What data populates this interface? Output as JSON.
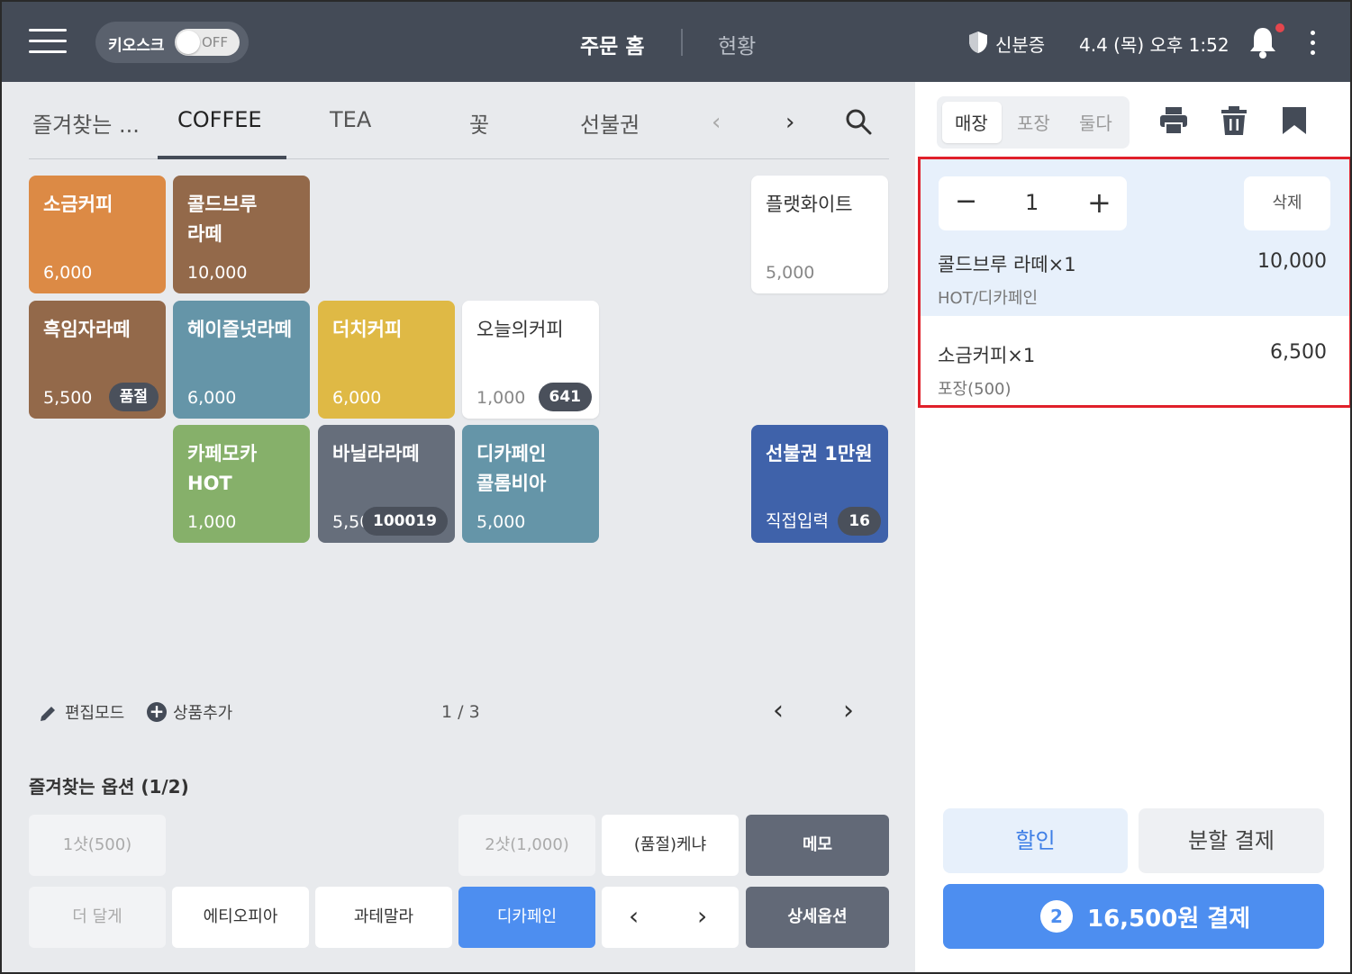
{
  "topbar": {
    "kiosk_label": "키오스크",
    "kiosk_toggle": "OFF",
    "nav_home": "주문 홈",
    "nav_status": "현황",
    "id_label": "신분증",
    "datetime": "4.4 (목) 오후 1:52"
  },
  "tabs": [
    "즐겨찾는 ...",
    "COFFEE",
    "TEA",
    "꽃",
    "선불권"
  ],
  "tiles": [
    {
      "name": "소금커피",
      "price": "6,000",
      "color": "#dc8a45"
    },
    {
      "name": "콜드브루\n라떼",
      "price": "10,000",
      "color": "#93694a"
    },
    {
      "name": "플랫화이트",
      "price": "5,000"
    },
    {
      "name": "흑임자라떼",
      "price": "5,500",
      "badge": "품절",
      "color": "#93694a"
    },
    {
      "name": "헤이즐넛라떼",
      "price": "6,000",
      "color": "#6595a8"
    },
    {
      "name": "더치커피",
      "price": "6,000",
      "color": "#dfb945"
    },
    {
      "name": "오늘의커피",
      "price": "1,000",
      "badge": "641"
    },
    {
      "name": "카페모카\nHOT",
      "price": "1,000",
      "color": "#86b06a"
    },
    {
      "name": "바닐라라떼",
      "price": "5,50",
      "badge": "100019",
      "color": "#666e7b"
    },
    {
      "name": "디카페인\n콜롬비아",
      "price": "5,000",
      "color": "#6595a8"
    },
    {
      "name": "선불권 1만원",
      "price": "직접입력",
      "badge": "16",
      "color": "#3f62aa"
    }
  ],
  "tools": {
    "edit_mode": "편집모드",
    "add_product": "상품추가",
    "page": "1 / 3"
  },
  "favorite_options": {
    "title": "즐겨찾는 옵션 (1/2)",
    "items": [
      "1샷(500)",
      "2샷(1,000)",
      "(품절)케냐",
      "메모",
      "더 달게",
      "에티오피아",
      "과테말라",
      "디카페인",
      "상세옵션"
    ]
  },
  "order": {
    "modes": [
      "매장",
      "포장",
      "둘다"
    ],
    "quantity": "1",
    "delete_label": "삭제",
    "items": [
      {
        "name": "콜드브루 라떼×1",
        "price": "10,000",
        "option": "HOT/디카페인"
      },
      {
        "name": "소금커피×1",
        "price": "6,500",
        "option": "포장(500)"
      }
    ]
  },
  "actions": {
    "discount": "할인",
    "split_pay": "분할 결제",
    "pay_count": "2",
    "pay_label": "16,500원 결제"
  },
  "colors": {
    "topbar": "#444b57",
    "accent_blue": "#4d8ef0",
    "highlight_red": "#e0202a"
  },
  "icons": [
    "menu-icon",
    "shield-icon",
    "bell-icon",
    "more-vertical-icon",
    "search-icon",
    "printer-icon",
    "trash-icon",
    "bookmark-icon",
    "pencil-icon",
    "plus-circle-icon",
    "chevron-left-icon",
    "chevron-right-icon"
  ]
}
